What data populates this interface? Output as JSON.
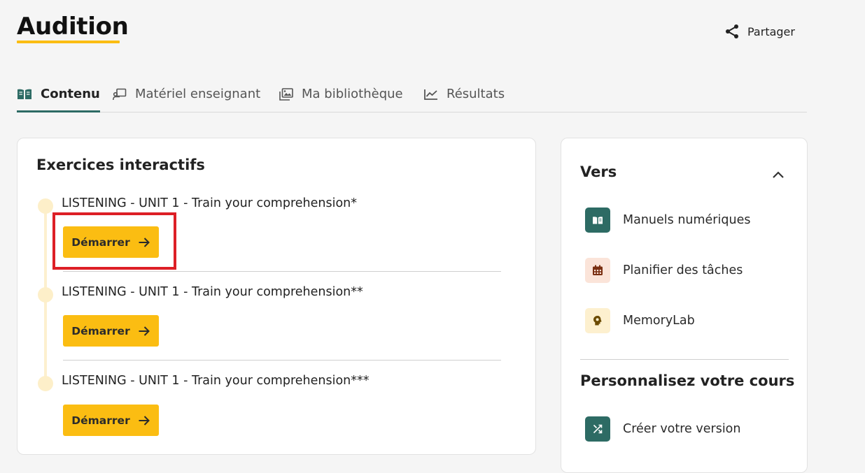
{
  "page": {
    "title": "Audition"
  },
  "header": {
    "share_label": "Partager"
  },
  "tabs": [
    {
      "label": "Contenu",
      "icon": "book-open-icon",
      "active": true
    },
    {
      "label": "Matériel enseignant",
      "icon": "teacher-board-icon",
      "active": false
    },
    {
      "label": "Ma bibliothèque",
      "icon": "image-library-icon",
      "active": false
    },
    {
      "label": "Résultats",
      "icon": "line-chart-icon",
      "active": false
    }
  ],
  "exercises_section": {
    "title": "Exercices interactifs",
    "items": [
      {
        "label": "LISTENING - UNIT 1 - Train your comprehension*",
        "button_label": "Démarrer"
      },
      {
        "label": "LISTENING - UNIT 1 - Train your comprehension**",
        "button_label": "Démarrer"
      },
      {
        "label": "LISTENING - UNIT 1 - Train your comprehension***",
        "button_label": "Démarrer"
      }
    ]
  },
  "sidebar": {
    "vers_title": "Vers",
    "items": [
      {
        "label": "Manuels numériques",
        "icon": "book-icon",
        "icon_bg": "#2d6b64",
        "icon_color": "#ffffff"
      },
      {
        "label": "Planifier des tâches",
        "icon": "calendar-icon",
        "icon_bg": "#fbe4d9",
        "icon_color": "#7a2f12"
      },
      {
        "label": "MemoryLab",
        "icon": "brain-icon",
        "icon_bg": "#fdf0cf",
        "icon_color": "#6b4a00"
      }
    ],
    "personalize_title": "Personnalisez votre cours",
    "personalize_items": [
      {
        "label": "Créer votre version",
        "icon": "shuffle-icon",
        "icon_bg": "#2d6b64",
        "icon_color": "#ffffff"
      }
    ]
  },
  "colors": {
    "accent_yellow": "#fbbd12",
    "accent_teal": "#2d6b64",
    "highlight_red": "#dd1f26"
  }
}
